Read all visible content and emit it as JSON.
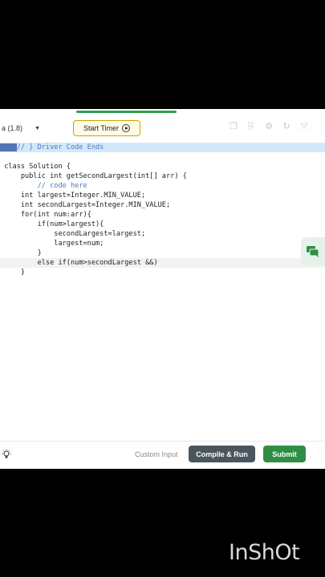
{
  "toolbar": {
    "language": "a (1.8)",
    "start_timer": "Start Timer",
    "icons": [
      "copy-icon",
      "reset-icon",
      "settings-icon",
      "refresh-icon",
      "fullscreen-icon"
    ]
  },
  "editor": {
    "lines": [
      {
        "text": "// } Driver Code Ends"
      },
      {
        "text": ""
      },
      {
        "text": "class Solution {"
      },
      {
        "text": "    public int getSecondLargest(int[] arr) {"
      },
      {
        "text": "        // code here"
      },
      {
        "text": "    int largest=Integer.MIN_VALUE;"
      },
      {
        "text": "    int secondLargest=Integer.MIN_VALUE;"
      },
      {
        "text": "    for(int num:arr){"
      },
      {
        "text": "        if(num>largest){"
      },
      {
        "text": "            secondLargest=largest;"
      },
      {
        "text": "            largest=num;"
      },
      {
        "text": "        }"
      },
      {
        "text": "        else if(num>secondLargest &&)"
      },
      {
        "text": "    }"
      }
    ]
  },
  "bottom": {
    "custom_input": "Custom Input",
    "compile_run": "Compile & Run",
    "submit": "Submit"
  },
  "watermark": "InShOt",
  "colors": {
    "submit_green": "#2f8d46",
    "compile_gray": "#4a555e",
    "timer_border": "#c9a400",
    "highlight_line": "#d4e8fb"
  }
}
